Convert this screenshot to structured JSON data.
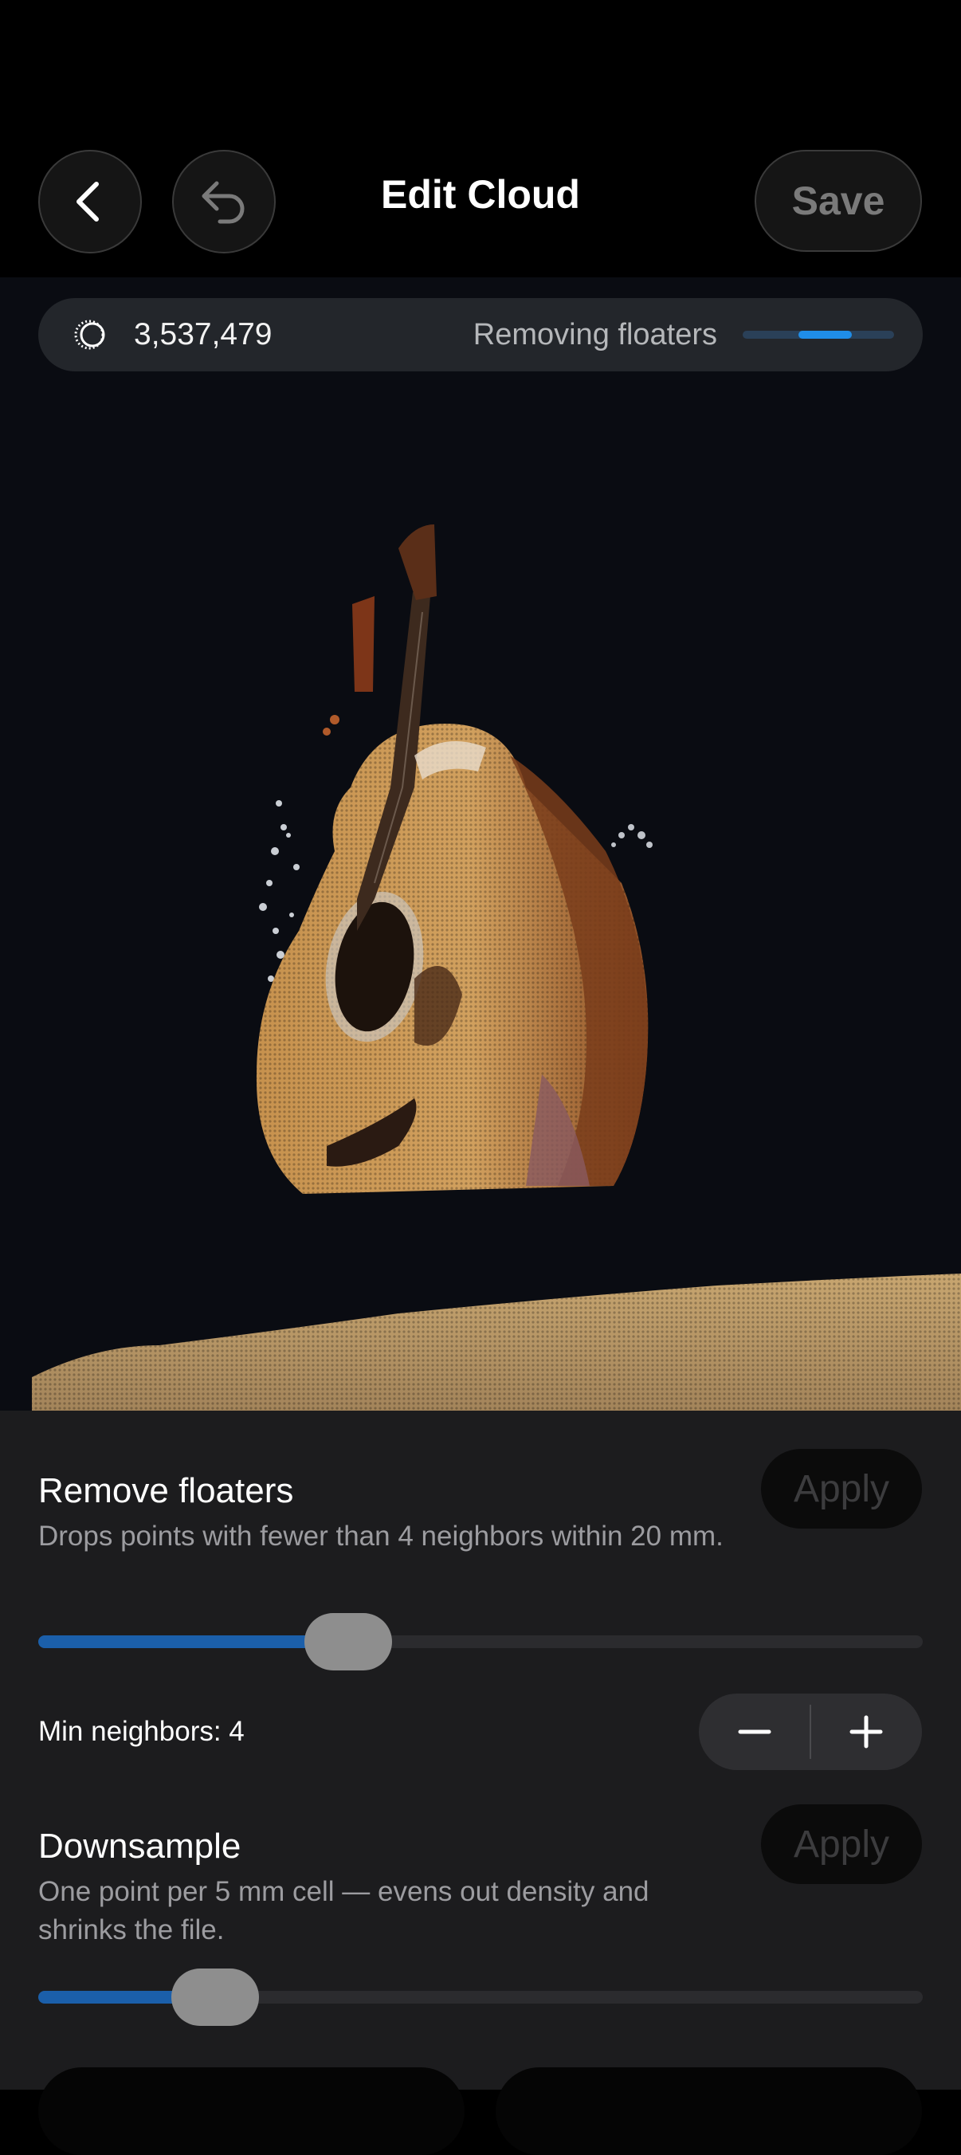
{
  "header": {
    "title": "Edit Cloud",
    "save_label": "Save",
    "back_icon": "chevron-left-icon",
    "undo_icon": "undo-arrow-icon"
  },
  "info_bar": {
    "icon": "point-cloud-icon",
    "point_count": "3,537,479",
    "status": "Removing floaters",
    "progress_fraction": 0.35
  },
  "sections": [
    {
      "title": "Remove floaters",
      "description": "Drops points with fewer than 4 neighbors within 20 mm.",
      "apply_label": "Apply",
      "slider_fraction": 0.35
    },
    {
      "title": "Downsample",
      "description": "One point per 5 mm cell — evens out density and shrinks the file.",
      "apply_label": "Apply",
      "slider_fraction": 0.2
    }
  ],
  "min_neighbors": {
    "label": "Min neighbors: 4",
    "decrement_icon": "minus-icon",
    "increment_icon": "plus-icon"
  },
  "colors": {
    "accent_blue": "#1f8de8",
    "slider_blue": "#1b5faa",
    "panel_bg": "#1c1c1e",
    "viewport_bg": "#0a0c12"
  }
}
